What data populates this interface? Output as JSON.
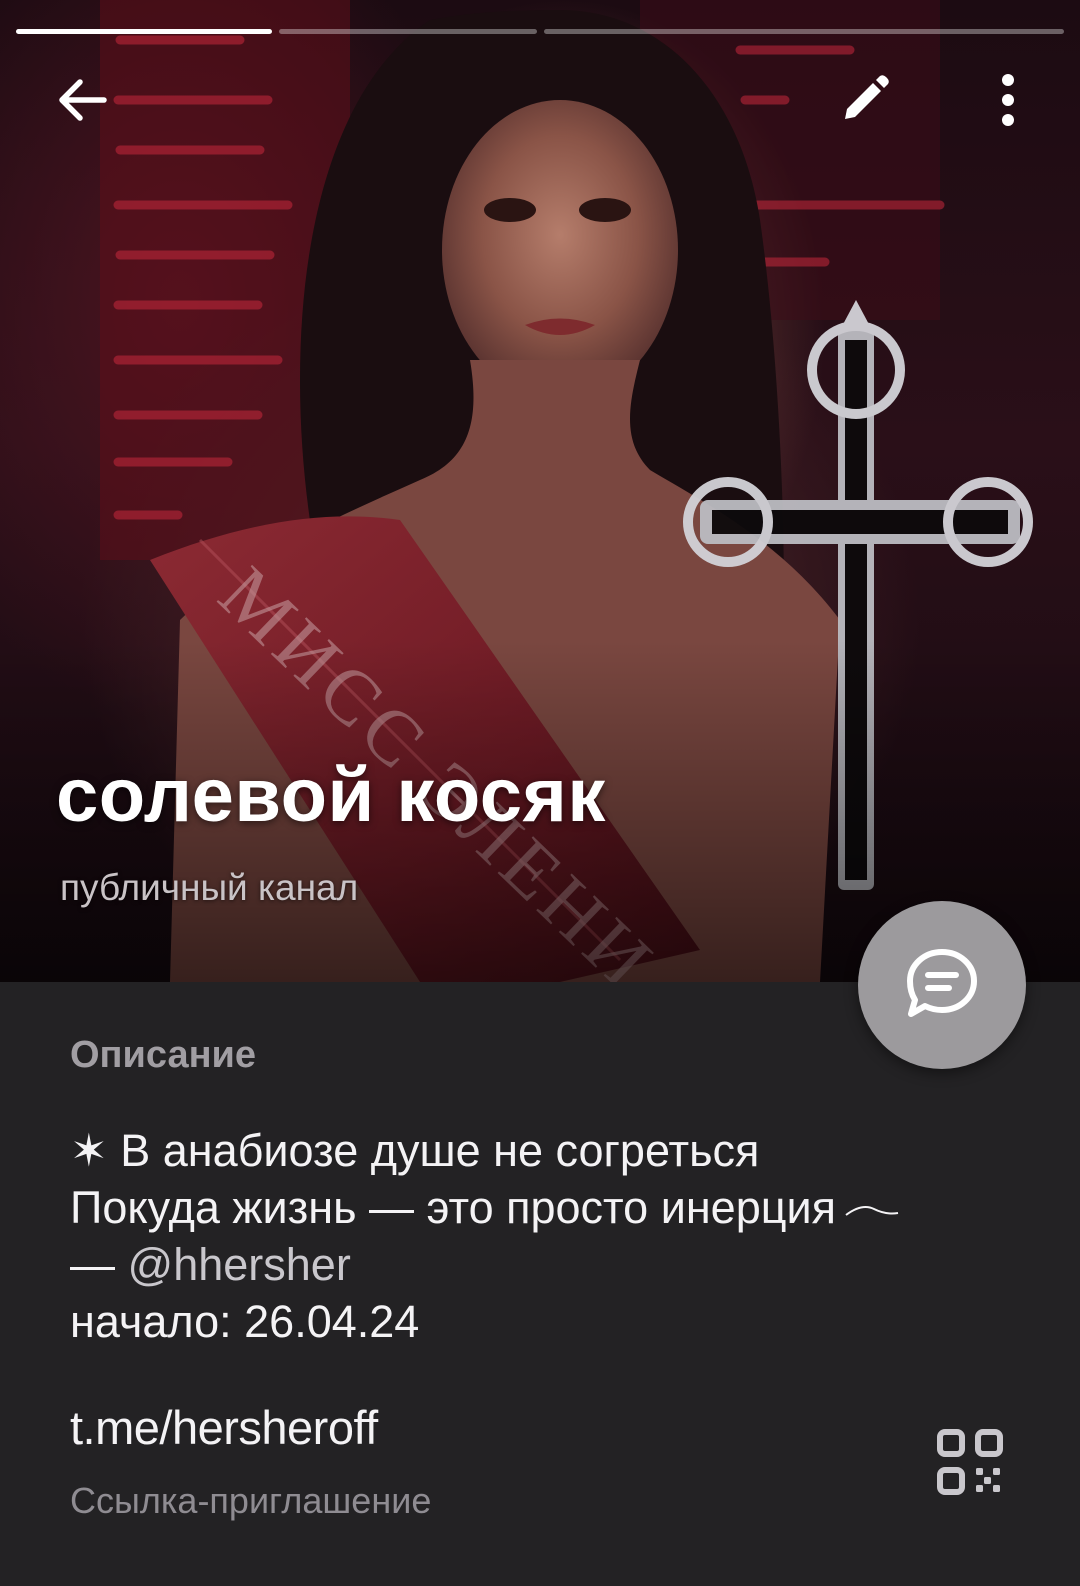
{
  "story_progress": [
    1.0,
    0.0,
    0.0
  ],
  "header": {
    "back_icon": "arrow-left-icon",
    "edit_icon": "pencil-icon",
    "menu_icon": "more-vertical-icon"
  },
  "channel": {
    "title": "солевой косяк",
    "subtitle": "публичный канал"
  },
  "info": {
    "section_label": "Описание",
    "description": {
      "line1": "✶ В анабиозе душе не согреться",
      "line2": "Покуда жизнь — это просто инерция",
      "line3_prefix": "— ",
      "line3_mention": "@hhersher",
      "line4": "начало: 26.04.24"
    },
    "link": "t.me/hersheroff",
    "link_caption": "Ссылка-приглашение",
    "qr_icon": "qr-code-icon"
  },
  "fab_icon": "chat-bubble-icon",
  "colors": {
    "background": "#232224",
    "section_label": "#a19ea3",
    "fab": "#9c9a9d",
    "caption": "#8f8c92"
  }
}
